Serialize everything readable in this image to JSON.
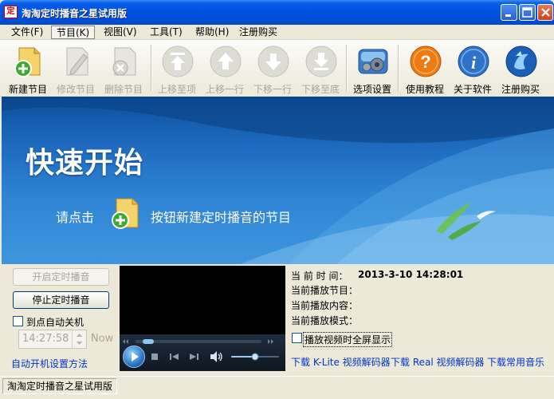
{
  "window": {
    "icon_glyph": "定",
    "title": "淘淘定时播音之星试用版",
    "buttons": [
      "minimize-icon",
      "maximize-icon",
      "close-icon"
    ]
  },
  "menu": {
    "items": [
      {
        "label": "文件(F)",
        "active": false
      },
      {
        "label": "节目(K)",
        "active": true
      },
      {
        "label": "视图(V)",
        "active": false
      },
      {
        "label": "工具(T)",
        "active": false
      },
      {
        "label": "帮助(H)",
        "active": false
      },
      {
        "label": "注册购买",
        "active": false
      }
    ]
  },
  "toolbar": {
    "new_program": "新建节目",
    "edit_program": "修改节目",
    "delete_program": "删除节目",
    "move_top": "上移至项",
    "move_up": "上移一行",
    "move_down": "下移一行",
    "move_bottom": "下移至底",
    "options": "选项设置",
    "tutorial": "使用教程",
    "about": "关于软件",
    "register": "注册购买"
  },
  "banner": {
    "title": "快速开始",
    "hint_before": "请点击",
    "hint_after": "按钮新建定时播音的节目"
  },
  "controls": {
    "start_button": "开启定时播音",
    "stop_button": "停止定时播音",
    "auto_shutdown_label": "到点自动关机",
    "time_value": "14:27:58",
    "now_label": "Now",
    "auto_boot_link": "自动开机设置方法"
  },
  "info": {
    "current_time_label": "当  前  时  间：",
    "current_time_value": "2013-3-10 14:28:01",
    "current_program_label": "当前播放节目：",
    "current_content_label": "当前播放内容：",
    "current_mode_label": "当前播放模式：",
    "fullscreen_label": "播放视频时全屏显示"
  },
  "links": {
    "klite": "下载 K-Lite 视频解码器",
    "real": "下载 Real 视频解码器",
    "music": "下载常用音乐"
  },
  "status": {
    "text": "淘淘定时播音之星试用版"
  },
  "colors": {
    "titlebar": "#0054E3",
    "banner": "#1E6BC0",
    "link": "#0033CC",
    "face": "#ECE9D8"
  }
}
